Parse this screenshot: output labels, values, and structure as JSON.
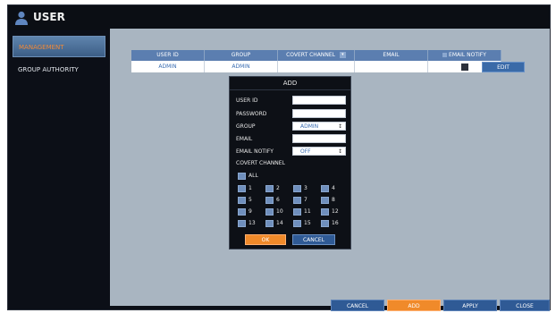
{
  "window": {
    "title": "USER",
    "user_icon": "user-icon"
  },
  "sidebar": {
    "items": [
      {
        "label": "MANAGEMENT",
        "active": true
      },
      {
        "label": "GROUP AUTHORITY",
        "active": false
      }
    ]
  },
  "table": {
    "headers": [
      "USER ID",
      "GROUP",
      "COVERT CHANNEL",
      "EMAIL",
      "EMAIL NOTIFY"
    ],
    "row": {
      "user_id": "ADMIN",
      "group": "ADMIN",
      "covert_channel": "",
      "email": "",
      "email_notify": false
    },
    "edit_label": "EDIT"
  },
  "dialog": {
    "title": "ADD",
    "labels": {
      "user_id": "USER ID",
      "password": "PASSWORD",
      "group": "GROUP",
      "email": "EMAIL",
      "email_notify": "EMAIL NOTIFY",
      "covert_channel": "COVERT CHANNEL"
    },
    "fields": {
      "group_value": "ADMIN",
      "email_notify_value": "OFF"
    },
    "channels": {
      "all_label": "ALL",
      "numbers": [
        "1",
        "2",
        "3",
        "4",
        "5",
        "6",
        "7",
        "8",
        "9",
        "10",
        "11",
        "12",
        "13",
        "14",
        "15",
        "16"
      ]
    },
    "ok_label": "OK",
    "cancel_label": "CANCEL"
  },
  "footer": {
    "cancel": "CANCEL",
    "add": "ADD",
    "apply": "APPLY",
    "close": "CLOSE"
  },
  "colors": {
    "accent_orange": "#f08a2a",
    "blue": "#2f5a95",
    "header_blue": "#5b7eb0",
    "background": "#a9b5c1"
  }
}
